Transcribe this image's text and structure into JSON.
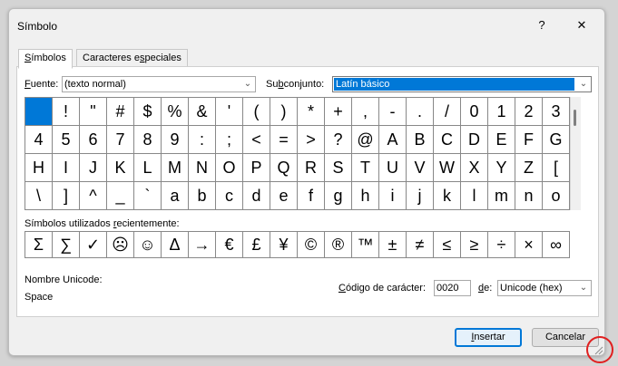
{
  "title": "Símbolo",
  "titlebar": {
    "help_label": "?",
    "close_label": "✕"
  },
  "tabs": [
    {
      "label_pre": "",
      "label_u": "S",
      "label_post": "ímbolos",
      "active": true
    },
    {
      "label_pre": "Caracteres e",
      "label_u": "s",
      "label_post": "peciales",
      "active": false
    }
  ],
  "font": {
    "label_u": "F",
    "label_post": "uente:",
    "value": "(texto normal)"
  },
  "subset": {
    "label_pre": "Su",
    "label_u": "b",
    "label_post": "conjunto:",
    "value": "Latín básico"
  },
  "symbols": [
    " ",
    "!",
    "\"",
    "#",
    "$",
    "%",
    "&",
    "'",
    "(",
    ")",
    "*",
    "+",
    ",",
    "-",
    ".",
    "/",
    "0",
    "1",
    "2",
    "3",
    "4",
    "5",
    "6",
    "7",
    "8",
    "9",
    ":",
    ";",
    "<",
    "=",
    ">",
    "?",
    "@",
    "A",
    "B",
    "C",
    "D",
    "E",
    "F",
    "G",
    "H",
    "I",
    "J",
    "K",
    "L",
    "M",
    "N",
    "O",
    "P",
    "Q",
    "R",
    "S",
    "T",
    "U",
    "V",
    "W",
    "X",
    "Y",
    "Z",
    "[",
    "\\",
    "]",
    "^",
    "_",
    "`",
    "a",
    "b",
    "c",
    "d",
    "e",
    "f",
    "g",
    "h",
    "i",
    "j",
    "k",
    "l",
    "m",
    "n",
    "o"
  ],
  "selected_index": 0,
  "recent": {
    "label_pre": "Símbolos utilizados ",
    "label_u": "r",
    "label_post": "ecientemente:",
    "symbols": [
      "Σ",
      "∑",
      "✓",
      "☹",
      "☺",
      "Δ",
      "→",
      "€",
      "£",
      "¥",
      "©",
      "®",
      "™",
      "±",
      "≠",
      "≤",
      "≥",
      "÷",
      "×",
      "∞"
    ]
  },
  "unicode_name": {
    "label": "Nombre Unicode:",
    "value": "Space"
  },
  "char_code": {
    "label_u": "C",
    "label_post": "ódigo de carácter:",
    "value": "0020"
  },
  "from": {
    "label_u": "d",
    "label_post": "e:",
    "value": "Unicode (hex)"
  },
  "buttons": {
    "insert": {
      "label_u": "I",
      "label_post": "nsertar"
    },
    "cancel": "Cancelar"
  }
}
